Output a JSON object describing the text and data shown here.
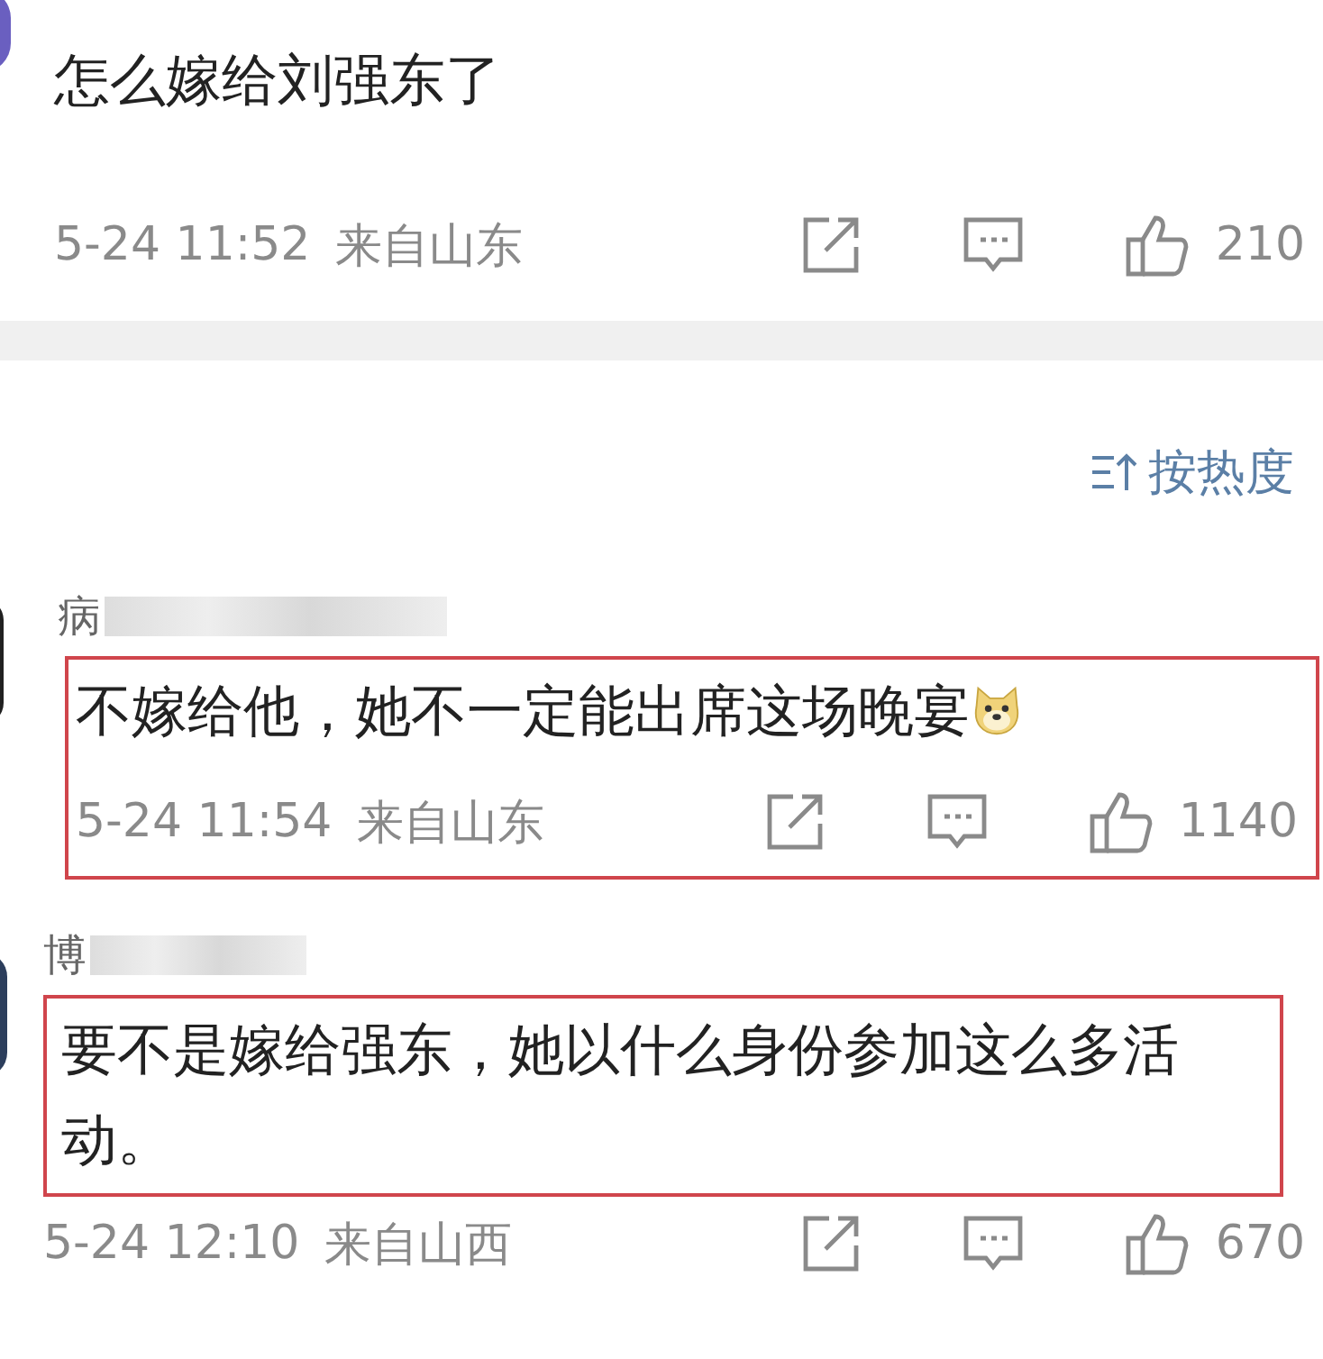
{
  "comments": [
    {
      "color": "#6a5fc0",
      "text": "怎么嫁给刘强东了",
      "emoji": false,
      "time": "5-24 11:52",
      "location": "来自山东",
      "likes": "210",
      "body_highlighted": false,
      "meta_highlighted": false
    },
    {
      "color": "#202020",
      "author": "病",
      "name_blurred": true,
      "text": "不嫁给他，她不一定能出席这场晚宴",
      "emoji": true,
      "time": "5-24 11:54",
      "location": "来自山东",
      "likes": "1140",
      "body_highlighted": true,
      "meta_highlighted": true
    },
    {
      "color": "#2c3e5c",
      "author": "博",
      "name_blurred": true,
      "text": "要不是嫁给强东，她以什么身份参加这么多活动。",
      "emoji": false,
      "time": "5-24 12:10",
      "location": "来自山西",
      "likes": "670",
      "body_highlighted": true,
      "meta_highlighted": false
    }
  ],
  "sort": {
    "label": "按热度"
  }
}
